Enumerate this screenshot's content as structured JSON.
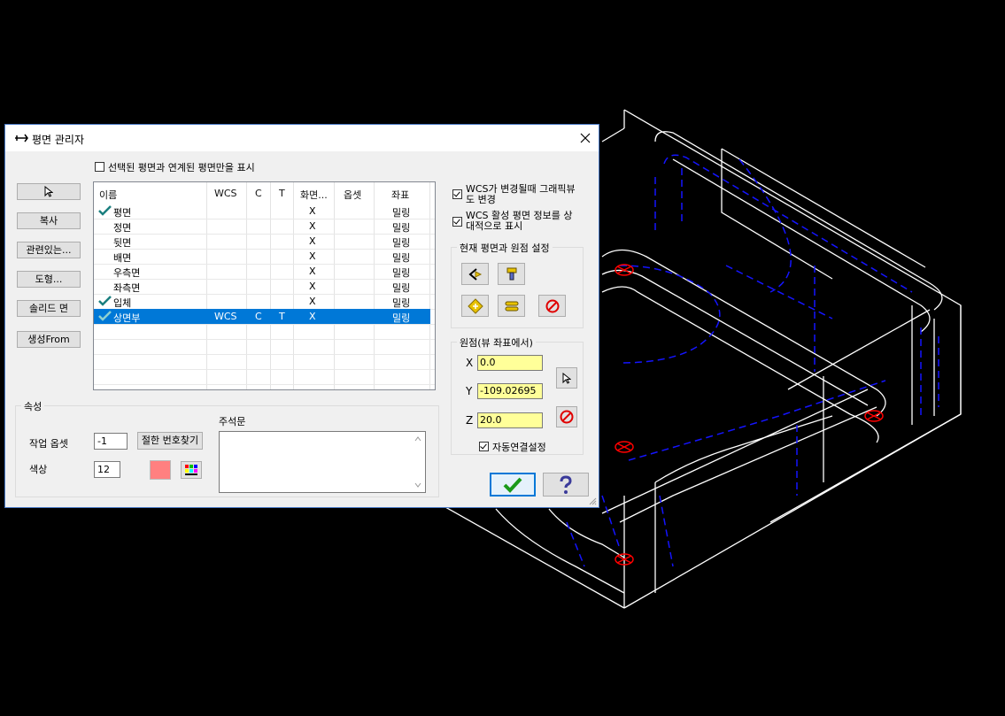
{
  "dialog": {
    "title": "평면 관리자",
    "show_related_only_label": "선택된 평면과 연계된 평면만을 표시",
    "side_buttons": [
      "복사",
      "관련있는...",
      "도형...",
      "솔리드 면",
      "생성From"
    ],
    "columns": [
      "이름",
      "WCS",
      "C",
      "T",
      "화면...",
      "옵셋",
      "좌표"
    ],
    "rows": [
      {
        "name": "평면",
        "wcs": "",
        "c": "",
        "t": "",
        "view": "X",
        "offset": "",
        "coord": "밀링",
        "checked": true,
        "selected": false
      },
      {
        "name": "정면",
        "wcs": "",
        "c": "",
        "t": "",
        "view": "X",
        "offset": "",
        "coord": "밀링",
        "checked": false,
        "selected": false
      },
      {
        "name": "뒷면",
        "wcs": "",
        "c": "",
        "t": "",
        "view": "X",
        "offset": "",
        "coord": "밀링",
        "checked": false,
        "selected": false
      },
      {
        "name": "배면",
        "wcs": "",
        "c": "",
        "t": "",
        "view": "X",
        "offset": "",
        "coord": "밀링",
        "checked": false,
        "selected": false
      },
      {
        "name": "우측면",
        "wcs": "",
        "c": "",
        "t": "",
        "view": "X",
        "offset": "",
        "coord": "밀링",
        "checked": false,
        "selected": false
      },
      {
        "name": "좌측면",
        "wcs": "",
        "c": "",
        "t": "",
        "view": "X",
        "offset": "",
        "coord": "밀링",
        "checked": false,
        "selected": false
      },
      {
        "name": "입체",
        "wcs": "",
        "c": "",
        "t": "",
        "view": "X",
        "offset": "",
        "coord": "밀링",
        "checked": true,
        "selected": false
      },
      {
        "name": "상면부",
        "wcs": "WCS",
        "c": "C",
        "t": "T",
        "view": "X",
        "offset": "",
        "coord": "밀링",
        "checked": true,
        "selected": true
      }
    ],
    "wcs_change_label_1": "WCS가 변경될때 그래픽뷰",
    "wcs_change_label_2": "도 변경",
    "wcs_active_label_1": "WCS 활성 평면 정보를 상",
    "wcs_active_label_2": "대적으로 표시",
    "current_plane_group": "현재 평면과 원점 설정",
    "origin_group": "원점(뷰 좌표에서)",
    "origin": {
      "x_label": "X",
      "x": "0.0",
      "y_label": "Y",
      "y": "-109.02695",
      "z_label": "Z",
      "z": "20.0"
    },
    "auto_link_label": "자동연결설정",
    "properties_group": "속성",
    "work_offset_label": "작업 옵셋",
    "work_offset_value": "-1",
    "find_number_button": "절한 번호찾기",
    "color_label": "색상",
    "color_value": "12",
    "color_swatch": "#ff8080",
    "comment_label": "주석문",
    "comment_value": ""
  },
  "colors": {
    "accent": "#0078d7",
    "field_yellow": "#ffff99",
    "cad_white": "#ffffff",
    "cad_blue": "#1414ff",
    "cad_red": "#ff0000"
  }
}
